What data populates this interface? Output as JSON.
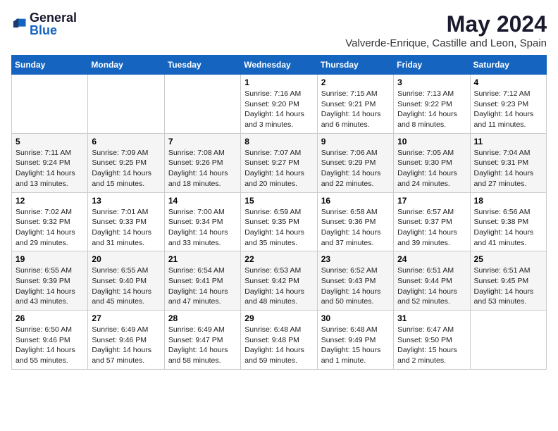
{
  "header": {
    "logo_general": "General",
    "logo_blue": "Blue",
    "month_title": "May 2024",
    "location": "Valverde-Enrique, Castille and Leon, Spain"
  },
  "days_of_week": [
    "Sunday",
    "Monday",
    "Tuesday",
    "Wednesday",
    "Thursday",
    "Friday",
    "Saturday"
  ],
  "weeks": [
    [
      {
        "day": "",
        "info": ""
      },
      {
        "day": "",
        "info": ""
      },
      {
        "day": "",
        "info": ""
      },
      {
        "day": "1",
        "sunrise": "Sunrise: 7:16 AM",
        "sunset": "Sunset: 9:20 PM",
        "daylight": "Daylight: 14 hours and 3 minutes."
      },
      {
        "day": "2",
        "sunrise": "Sunrise: 7:15 AM",
        "sunset": "Sunset: 9:21 PM",
        "daylight": "Daylight: 14 hours and 6 minutes."
      },
      {
        "day": "3",
        "sunrise": "Sunrise: 7:13 AM",
        "sunset": "Sunset: 9:22 PM",
        "daylight": "Daylight: 14 hours and 8 minutes."
      },
      {
        "day": "4",
        "sunrise": "Sunrise: 7:12 AM",
        "sunset": "Sunset: 9:23 PM",
        "daylight": "Daylight: 14 hours and 11 minutes."
      }
    ],
    [
      {
        "day": "5",
        "sunrise": "Sunrise: 7:11 AM",
        "sunset": "Sunset: 9:24 PM",
        "daylight": "Daylight: 14 hours and 13 minutes."
      },
      {
        "day": "6",
        "sunrise": "Sunrise: 7:09 AM",
        "sunset": "Sunset: 9:25 PM",
        "daylight": "Daylight: 14 hours and 15 minutes."
      },
      {
        "day": "7",
        "sunrise": "Sunrise: 7:08 AM",
        "sunset": "Sunset: 9:26 PM",
        "daylight": "Daylight: 14 hours and 18 minutes."
      },
      {
        "day": "8",
        "sunrise": "Sunrise: 7:07 AM",
        "sunset": "Sunset: 9:27 PM",
        "daylight": "Daylight: 14 hours and 20 minutes."
      },
      {
        "day": "9",
        "sunrise": "Sunrise: 7:06 AM",
        "sunset": "Sunset: 9:29 PM",
        "daylight": "Daylight: 14 hours and 22 minutes."
      },
      {
        "day": "10",
        "sunrise": "Sunrise: 7:05 AM",
        "sunset": "Sunset: 9:30 PM",
        "daylight": "Daylight: 14 hours and 24 minutes."
      },
      {
        "day": "11",
        "sunrise": "Sunrise: 7:04 AM",
        "sunset": "Sunset: 9:31 PM",
        "daylight": "Daylight: 14 hours and 27 minutes."
      }
    ],
    [
      {
        "day": "12",
        "sunrise": "Sunrise: 7:02 AM",
        "sunset": "Sunset: 9:32 PM",
        "daylight": "Daylight: 14 hours and 29 minutes."
      },
      {
        "day": "13",
        "sunrise": "Sunrise: 7:01 AM",
        "sunset": "Sunset: 9:33 PM",
        "daylight": "Daylight: 14 hours and 31 minutes."
      },
      {
        "day": "14",
        "sunrise": "Sunrise: 7:00 AM",
        "sunset": "Sunset: 9:34 PM",
        "daylight": "Daylight: 14 hours and 33 minutes."
      },
      {
        "day": "15",
        "sunrise": "Sunrise: 6:59 AM",
        "sunset": "Sunset: 9:35 PM",
        "daylight": "Daylight: 14 hours and 35 minutes."
      },
      {
        "day": "16",
        "sunrise": "Sunrise: 6:58 AM",
        "sunset": "Sunset: 9:36 PM",
        "daylight": "Daylight: 14 hours and 37 minutes."
      },
      {
        "day": "17",
        "sunrise": "Sunrise: 6:57 AM",
        "sunset": "Sunset: 9:37 PM",
        "daylight": "Daylight: 14 hours and 39 minutes."
      },
      {
        "day": "18",
        "sunrise": "Sunrise: 6:56 AM",
        "sunset": "Sunset: 9:38 PM",
        "daylight": "Daylight: 14 hours and 41 minutes."
      }
    ],
    [
      {
        "day": "19",
        "sunrise": "Sunrise: 6:55 AM",
        "sunset": "Sunset: 9:39 PM",
        "daylight": "Daylight: 14 hours and 43 minutes."
      },
      {
        "day": "20",
        "sunrise": "Sunrise: 6:55 AM",
        "sunset": "Sunset: 9:40 PM",
        "daylight": "Daylight: 14 hours and 45 minutes."
      },
      {
        "day": "21",
        "sunrise": "Sunrise: 6:54 AM",
        "sunset": "Sunset: 9:41 PM",
        "daylight": "Daylight: 14 hours and 47 minutes."
      },
      {
        "day": "22",
        "sunrise": "Sunrise: 6:53 AM",
        "sunset": "Sunset: 9:42 PM",
        "daylight": "Daylight: 14 hours and 48 minutes."
      },
      {
        "day": "23",
        "sunrise": "Sunrise: 6:52 AM",
        "sunset": "Sunset: 9:43 PM",
        "daylight": "Daylight: 14 hours and 50 minutes."
      },
      {
        "day": "24",
        "sunrise": "Sunrise: 6:51 AM",
        "sunset": "Sunset: 9:44 PM",
        "daylight": "Daylight: 14 hours and 52 minutes."
      },
      {
        "day": "25",
        "sunrise": "Sunrise: 6:51 AM",
        "sunset": "Sunset: 9:45 PM",
        "daylight": "Daylight: 14 hours and 53 minutes."
      }
    ],
    [
      {
        "day": "26",
        "sunrise": "Sunrise: 6:50 AM",
        "sunset": "Sunset: 9:46 PM",
        "daylight": "Daylight: 14 hours and 55 minutes."
      },
      {
        "day": "27",
        "sunrise": "Sunrise: 6:49 AM",
        "sunset": "Sunset: 9:46 PM",
        "daylight": "Daylight: 14 hours and 57 minutes."
      },
      {
        "day": "28",
        "sunrise": "Sunrise: 6:49 AM",
        "sunset": "Sunset: 9:47 PM",
        "daylight": "Daylight: 14 hours and 58 minutes."
      },
      {
        "day": "29",
        "sunrise": "Sunrise: 6:48 AM",
        "sunset": "Sunset: 9:48 PM",
        "daylight": "Daylight: 14 hours and 59 minutes."
      },
      {
        "day": "30",
        "sunrise": "Sunrise: 6:48 AM",
        "sunset": "Sunset: 9:49 PM",
        "daylight": "Daylight: 15 hours and 1 minute."
      },
      {
        "day": "31",
        "sunrise": "Sunrise: 6:47 AM",
        "sunset": "Sunset: 9:50 PM",
        "daylight": "Daylight: 15 hours and 2 minutes."
      },
      {
        "day": "",
        "info": ""
      }
    ]
  ]
}
